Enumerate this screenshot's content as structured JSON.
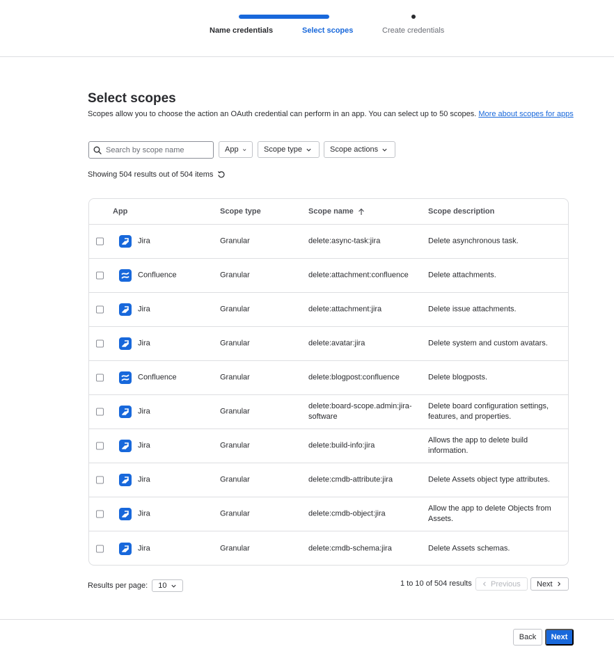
{
  "stepper": {
    "steps": [
      {
        "label": "Name credentials",
        "state": "done"
      },
      {
        "label": "Select scopes",
        "state": "active"
      },
      {
        "label": "Create credentials",
        "state": "todo"
      }
    ]
  },
  "page": {
    "title": "Select scopes",
    "description": "Scopes allow you to choose the action an OAuth credential can perform in an app. You can select up to 50 scopes.",
    "link_text": "More about scopes for apps"
  },
  "filters": {
    "search_placeholder": "Search by scope name",
    "app_label": "App",
    "scope_type_label": "Scope type",
    "scope_actions_label": "Scope actions"
  },
  "results_summary": "Showing 504 results out of 504 items",
  "table": {
    "headers": {
      "app": "App",
      "scope_type": "Scope type",
      "scope_name": "Scope name",
      "scope_description": "Scope description"
    },
    "rows": [
      {
        "app": "Jira",
        "icon": "jira-icon",
        "type": "Granular",
        "name": "delete:async-task:jira",
        "desc": "Delete asynchronous task."
      },
      {
        "app": "Confluence",
        "icon": "confluence-icon",
        "type": "Granular",
        "name": "delete:attachment:confluence",
        "desc": "Delete attachments."
      },
      {
        "app": "Jira",
        "icon": "jira-icon",
        "type": "Granular",
        "name": "delete:attachment:jira",
        "desc": "Delete issue attachments."
      },
      {
        "app": "Jira",
        "icon": "jira-icon",
        "type": "Granular",
        "name": "delete:avatar:jira",
        "desc": "Delete system and custom avatars."
      },
      {
        "app": "Confluence",
        "icon": "confluence-icon",
        "type": "Granular",
        "name": "delete:blogpost:confluence",
        "desc": "Delete blogposts."
      },
      {
        "app": "Jira",
        "icon": "jira-icon",
        "type": "Granular",
        "name": "delete:board-scope.admin:jira-software",
        "desc": "Delete board configuration settings, features, and properties."
      },
      {
        "app": "Jira",
        "icon": "jira-icon",
        "type": "Granular",
        "name": "delete:build-info:jira",
        "desc": "Allows the app to delete build information."
      },
      {
        "app": "Jira",
        "icon": "jira-icon",
        "type": "Granular",
        "name": "delete:cmdb-attribute:jira",
        "desc": "Delete Assets object type attributes."
      },
      {
        "app": "Jira",
        "icon": "jira-icon",
        "type": "Granular",
        "name": "delete:cmdb-object:jira",
        "desc": "Allow the app to delete Objects from Assets."
      },
      {
        "app": "Jira",
        "icon": "jira-icon",
        "type": "Granular",
        "name": "delete:cmdb-schema:jira",
        "desc": "Delete Assets schemas."
      }
    ]
  },
  "pagination": {
    "per_page_label": "Results per page:",
    "per_page_value": "10",
    "range_text": "1 to 10 of 504 results",
    "previous_label": "Previous",
    "next_label": "Next"
  },
  "footer": {
    "back_label": "Back",
    "next_label": "Next"
  },
  "colors": {
    "accent": "#1868db",
    "text": "#292a2e",
    "border": "#dddee1"
  }
}
